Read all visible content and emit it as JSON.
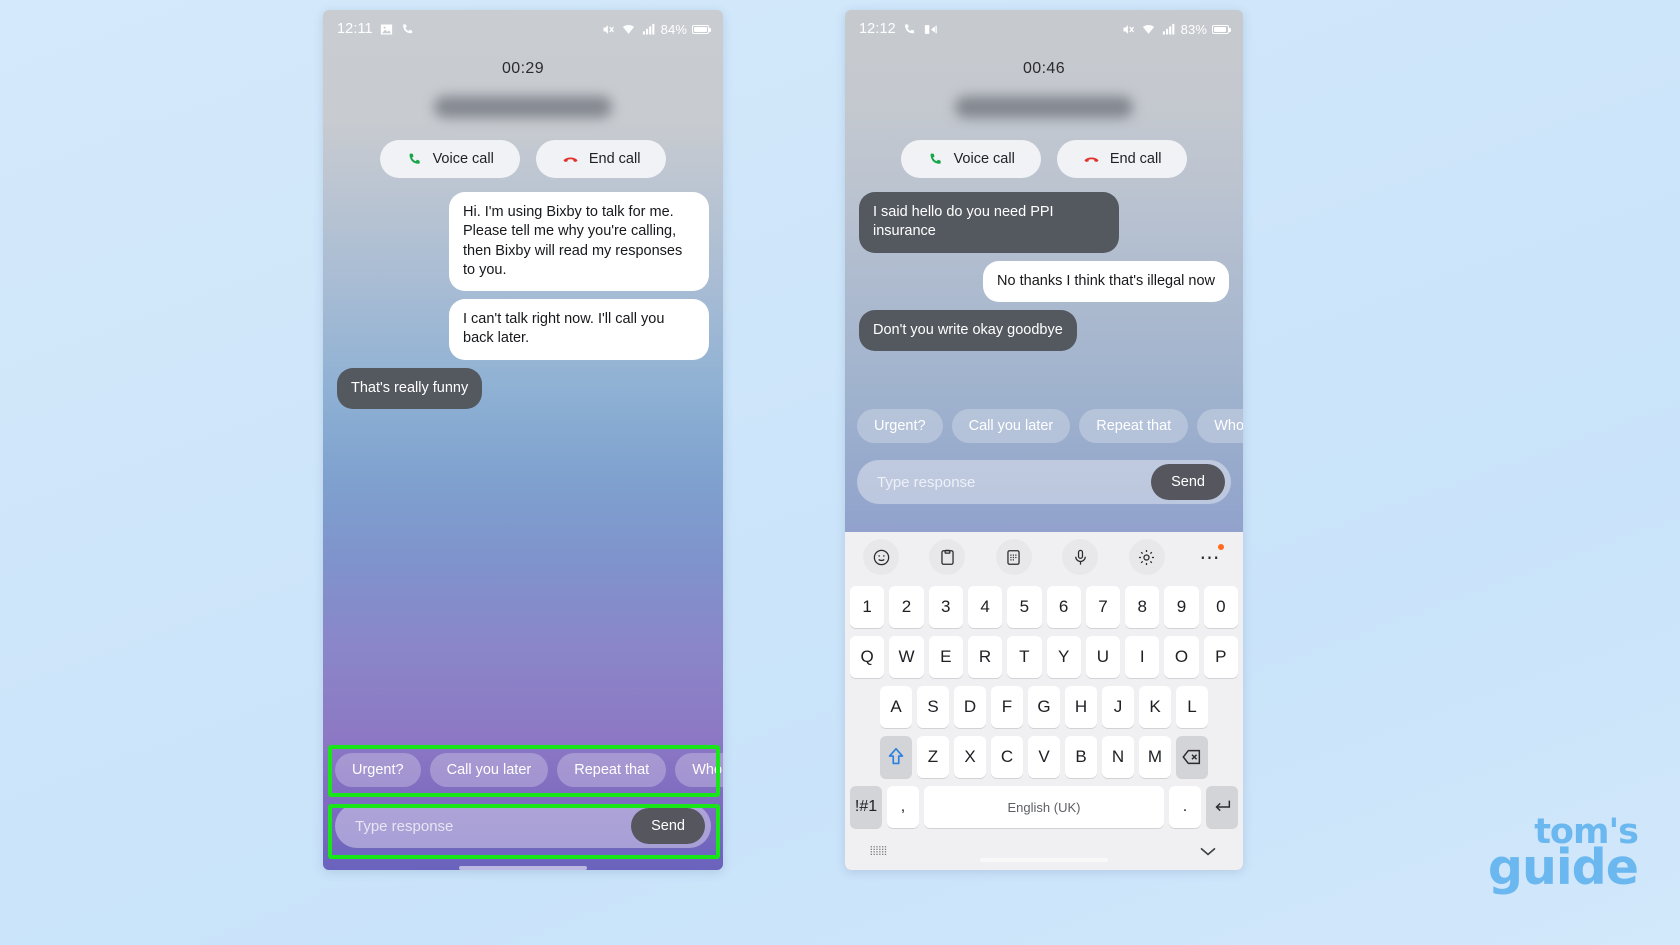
{
  "background": {
    "color_top": "#d4e9fb",
    "color_bottom": "#d2e8fb"
  },
  "watermark": {
    "line1": "tom's",
    "line2": "guide",
    "color": "#6bb7ef"
  },
  "annotation": {
    "color": "#19e619",
    "targets": [
      "quick-reply-row",
      "composer-bar"
    ]
  },
  "phone_left": {
    "status_bar": {
      "time": "12:11",
      "left_icons": [
        "image-icon",
        "phone-icon"
      ],
      "right_icons": [
        "mute-icon",
        "wifi-icon",
        "signal-icon"
      ],
      "battery_text": "84%",
      "battery_level": 84
    },
    "call": {
      "timer": "00:29",
      "contact_name_blurred": true,
      "voice_call_label": "Voice call",
      "end_call_label": "End call"
    },
    "messages": [
      {
        "side": "me",
        "text": "Hi. I'm using Bixby to talk for me. Please tell me why you're calling, then Bixby will read my responses to you."
      },
      {
        "side": "me",
        "text": "I can't talk right now. I'll call you back later."
      },
      {
        "side": "them",
        "text": "That's really funny"
      }
    ],
    "quick_replies": [
      "Urgent?",
      "Call you later",
      "Repeat that",
      "Who a"
    ],
    "composer": {
      "placeholder": "Type response",
      "value": "",
      "send_label": "Send"
    }
  },
  "phone_right": {
    "status_bar": {
      "time": "12:12",
      "left_icons": [
        "phone-icon",
        "call-forward-icon"
      ],
      "right_icons": [
        "mute-icon",
        "wifi-icon",
        "signal-icon"
      ],
      "battery_text": "83%",
      "battery_level": 83
    },
    "call": {
      "timer": "00:46",
      "contact_name_blurred": true,
      "voice_call_label": "Voice call",
      "end_call_label": "End call"
    },
    "messages": [
      {
        "side": "them",
        "text": "I said hello do you need PPI insurance"
      },
      {
        "side": "me",
        "text": "No thanks I think that's illegal now"
      },
      {
        "side": "them",
        "text": "Don't you write okay goodbye"
      }
    ],
    "quick_replies": [
      "Urgent?",
      "Call you later",
      "Repeat that",
      "Who a"
    ],
    "composer": {
      "placeholder": "Type response",
      "value": "",
      "send_label": "Send"
    },
    "keyboard": {
      "toolbar_icons": [
        "emoji-icon",
        "clipboard-icon",
        "sticker-icon",
        "microphone-icon",
        "gear-icon",
        "more-options-icon"
      ],
      "row_numbers": [
        "1",
        "2",
        "3",
        "4",
        "5",
        "6",
        "7",
        "8",
        "9",
        "0"
      ],
      "row_top": [
        "Q",
        "W",
        "E",
        "R",
        "T",
        "Y",
        "U",
        "I",
        "O",
        "P"
      ],
      "row_home": [
        "A",
        "S",
        "D",
        "F",
        "G",
        "H",
        "J",
        "K",
        "L"
      ],
      "row_bottom": [
        "Z",
        "X",
        "C",
        "V",
        "B",
        "N",
        "M"
      ],
      "shift_label": "shift-icon",
      "backspace_label": "backspace-icon",
      "symbols_label": "!#1",
      "comma_label": ",",
      "space_label": "English (UK)",
      "period_label": ".",
      "enter_label": "enter-icon",
      "keyboard_switch_icon": "keyboard-icon",
      "hide_keyboard_icon": "chevron-down-icon"
    }
  }
}
